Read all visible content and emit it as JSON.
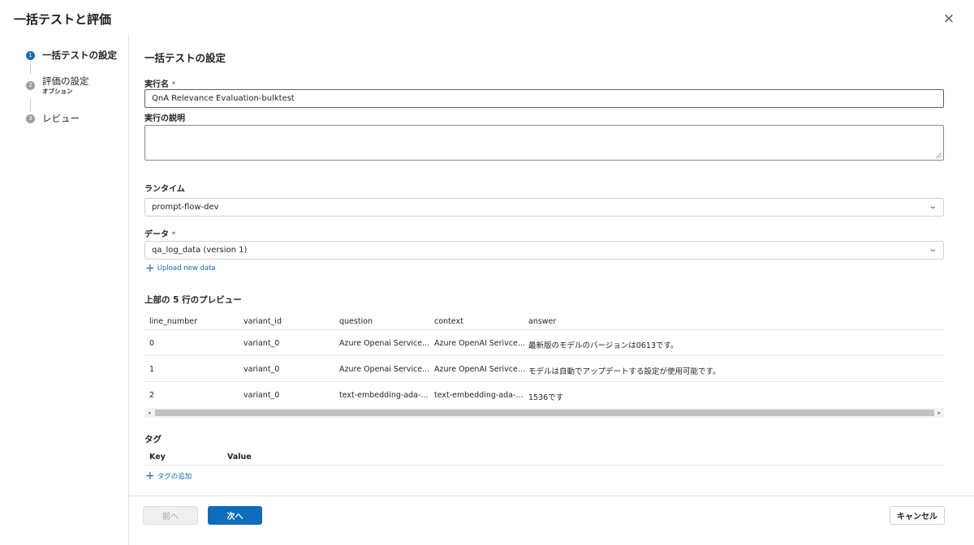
{
  "dialog": {
    "title": "一括テストと評価",
    "close_icon": "×"
  },
  "steps": [
    {
      "number": "1",
      "label": "一括テストの設定",
      "sublabel": "",
      "state": "active"
    },
    {
      "number": "2",
      "label": "評価の設定",
      "sublabel": "オプション",
      "state": "inactive"
    },
    {
      "number": "3",
      "label": "レビュー",
      "sublabel": "",
      "state": "inactive"
    }
  ],
  "form": {
    "section_title": "一括テストの設定",
    "run_name": {
      "label": "実行名",
      "required_mark": "*",
      "value": "QnA Relevance Evaluation-bulktest"
    },
    "run_description": {
      "label": "実行の説明",
      "value": ""
    },
    "runtime": {
      "label": "ランタイム",
      "value": "prompt-flow-dev"
    },
    "data": {
      "label": "データ",
      "required_mark": "*",
      "value": "qa_log_data (version 1)"
    },
    "upload_link": {
      "icon": "+",
      "label": "Upload new data"
    }
  },
  "preview": {
    "title": "上部の 5 行のプレビュー",
    "columns": [
      "line_number",
      "variant_id",
      "question",
      "context",
      "answer"
    ],
    "rows": [
      [
        "0",
        "variant_0",
        "Azure Openai Service...",
        "Azure OpenAI Serivce...",
        "最新版のモデルのバージョンは0613です。"
      ],
      [
        "1",
        "variant_0",
        "Azure Openai Service...",
        "Azure OpenAI Serivce...",
        "モデルは自動でアップデートする設定が使用可能です。"
      ],
      [
        "2",
        "variant_0",
        "text-embedding-ada-...",
        "text-embedding-ada-...",
        "1536です"
      ]
    ],
    "scroll_left_icon": "◂",
    "scroll_right_icon": "▸"
  },
  "tags": {
    "title": "タグ",
    "columns": [
      "Key",
      "Value"
    ],
    "add_link": {
      "icon": "+",
      "label": "タグの追加"
    }
  },
  "footer": {
    "prev_label": "前へ",
    "next_label": "次へ",
    "cancel_label": "キャンセル"
  },
  "colors": {
    "accent": "#0f6cbd",
    "required": "#c4314b",
    "border": "#d1d1d1"
  }
}
